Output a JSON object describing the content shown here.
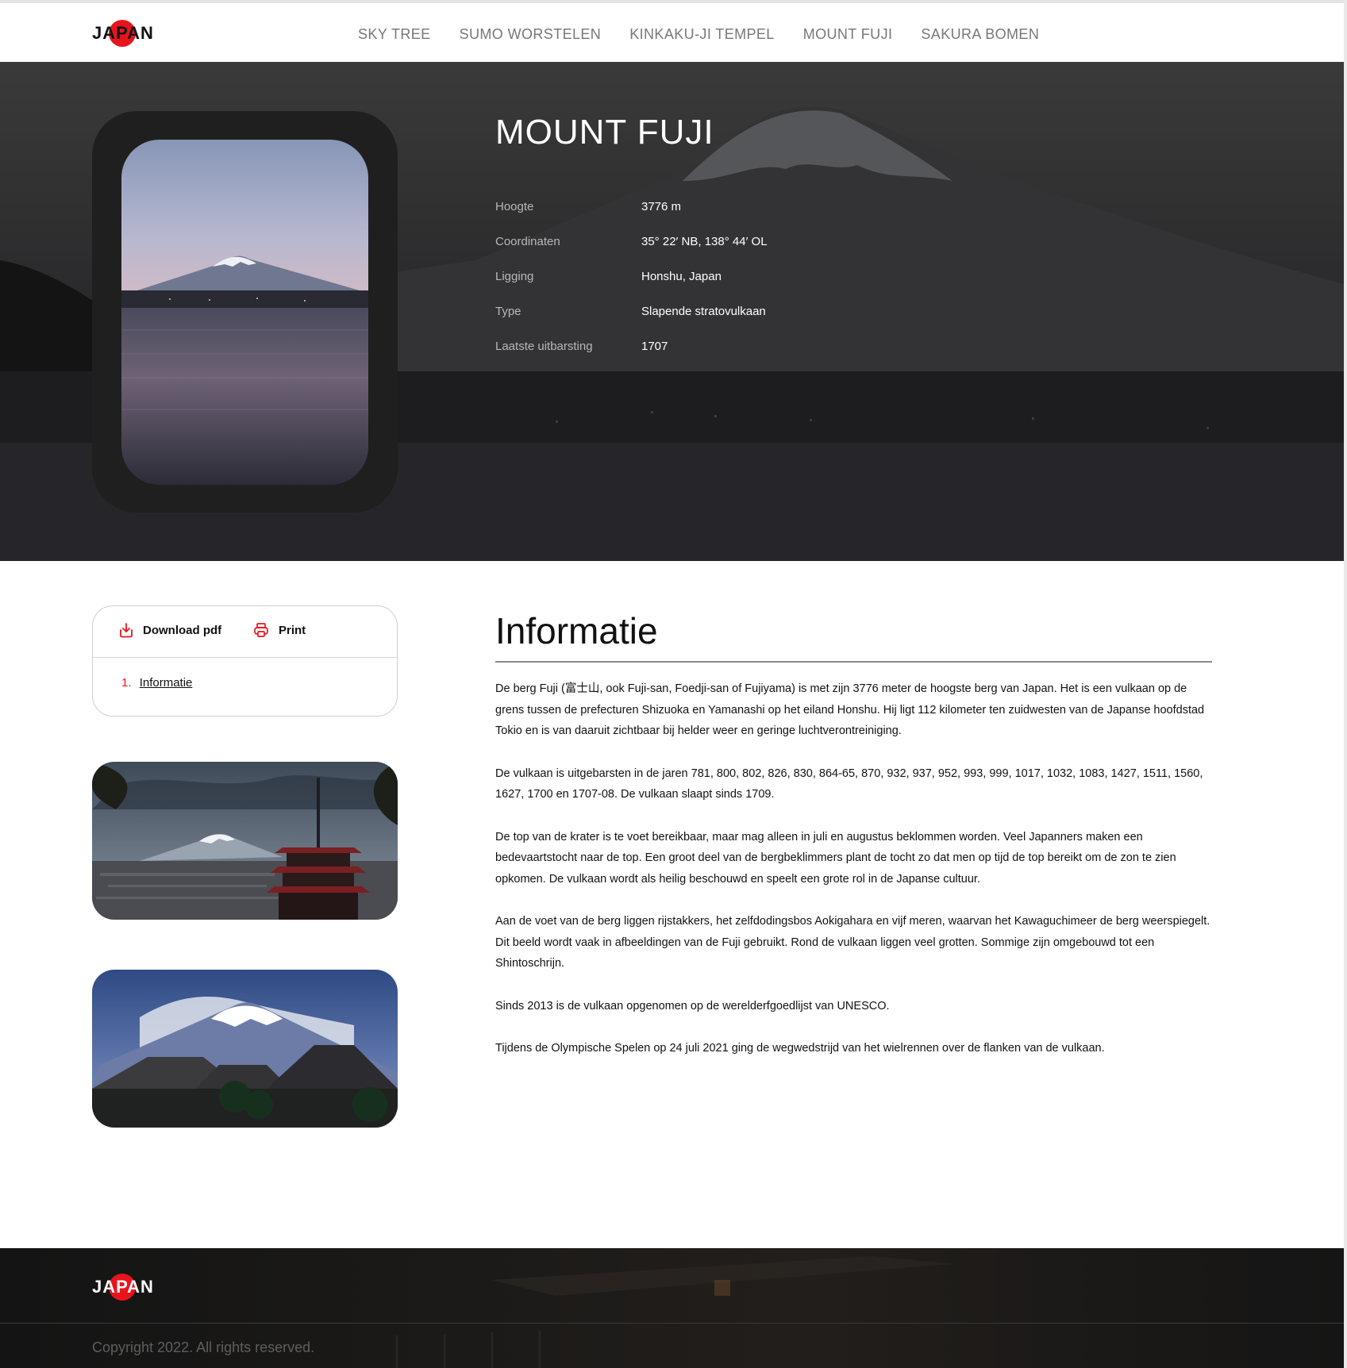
{
  "brand": {
    "logo_text": "JAPAN"
  },
  "nav": {
    "items": [
      {
        "label": "SKY TREE"
      },
      {
        "label": "SUMO WORSTELEN"
      },
      {
        "label": "KINKAKU-JI TEMPEL"
      },
      {
        "label": "MOUNT FUJI"
      },
      {
        "label": "SAKURA BOMEN"
      }
    ]
  },
  "hero": {
    "title": "MOUNT FUJI",
    "facts": [
      {
        "key": "Hoogte",
        "value": "3776 m"
      },
      {
        "key": "Coordinaten",
        "value": "35° 22′ NB, 138° 44′ OL"
      },
      {
        "key": "Ligging",
        "value": "Honshu, Japan"
      },
      {
        "key": "Type",
        "value": "Slapende stratovulkaan"
      },
      {
        "key": "Laatste uitbarsting",
        "value": "1707"
      }
    ]
  },
  "sidebar": {
    "download_label": "Download pdf",
    "print_label": "Print",
    "toc": [
      {
        "number": "1.",
        "label": "Informatie"
      }
    ]
  },
  "article": {
    "heading": "Informatie",
    "paragraphs": [
      "De berg Fuji (富士山, ook Fuji-san, Foedji-san of Fujiyama) is met zijn 3776 meter de hoogste berg van Japan. Het is een vulkaan op de grens tussen de prefecturen Shizuoka en Yamanashi op het eiland Honshu. Hij ligt 112 kilometer ten zuidwesten van de Japanse hoofdstad Tokio en is van daaruit zichtbaar bij helder weer en geringe luchtverontreiniging.",
      "De vulkaan is uitgebarsten in de jaren 781, 800, 802, 826, 830, 864-65, 870, 932, 937, 952, 993, 999, 1017, 1032, 1083, 1427, 1511, 1560, 1627, 1700 en 1707-08. De vulkaan slaapt sinds 1709.",
      "De top van de krater is te voet bereikbaar, maar mag alleen in juli en augustus beklommen worden. Veel Japanners maken een bedevaartstocht naar de top. Een groot deel van de bergbeklimmers plant de tocht zo dat men op tijd de top bereikt om de zon te zien opkomen. De vulkaan wordt als heilig beschouwd en speelt een grote rol in de Japanse cultuur.",
      "Aan de voet van de berg liggen rijstakkers, het zelfdodingsbos Aokigahara en vijf meren, waarvan het Kawaguchimeer de berg weerspiegelt. Dit beeld wordt vaak in afbeeldingen van de Fuji gebruikt. Rond de vulkaan liggen veel grotten. Sommige zijn omgebouwd tot een Shintoschrijn.",
      "Sinds 2013 is de vulkaan opgenomen op de werelderfgoedlijst van UNESCO.",
      "Tijdens de Olympische Spelen op 24 juli 2021 ging de wegwedstrijd van het wielrennen over de flanken van de vulkaan."
    ]
  },
  "footer": {
    "logo_text": "JAPAN",
    "copyright": "Copyright 2022.  All rights reserved."
  },
  "colors": {
    "accent": "#e8141c",
    "nav_text": "#777777",
    "hero_text": "#ffffff"
  },
  "icons": {
    "download": "download-icon",
    "print": "print-icon"
  }
}
